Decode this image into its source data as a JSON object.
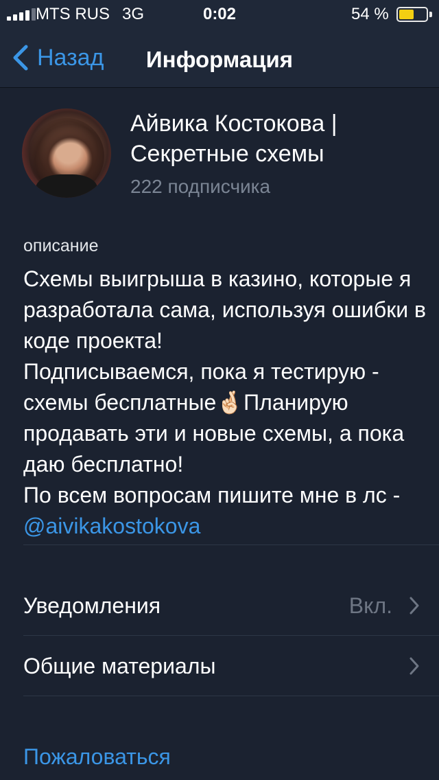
{
  "status_bar": {
    "carrier": "MTS RUS",
    "network": "3G",
    "time": "0:02",
    "battery_percent": "54 %",
    "battery_level": 0.54
  },
  "nav": {
    "back_label": "Назад",
    "title": "Информация"
  },
  "profile": {
    "name": "Айвика Костокова | Секретные схемы",
    "subscribers": "222 подписчика"
  },
  "description": {
    "label": "описание",
    "text": "Схемы выигрыша в казино, которые я разработала сама, используя ошибки в коде проекта!\nПодписываемся, пока я тестирую - схемы бесплатные🤞🏻Планирую продавать эти и новые схемы, а пока даю бесплатно!\nПо всем вопросам пишите мне в лс - ",
    "link": "@aivikakostokova"
  },
  "settings": {
    "notifications_label": "Уведомления",
    "notifications_value": "Вкл.",
    "shared_media_label": "Общие материалы"
  },
  "report_label": "Пожаловаться",
  "colors": {
    "background": "#1b2230",
    "accent": "#3b96e6",
    "battery": "#f2cf12"
  }
}
